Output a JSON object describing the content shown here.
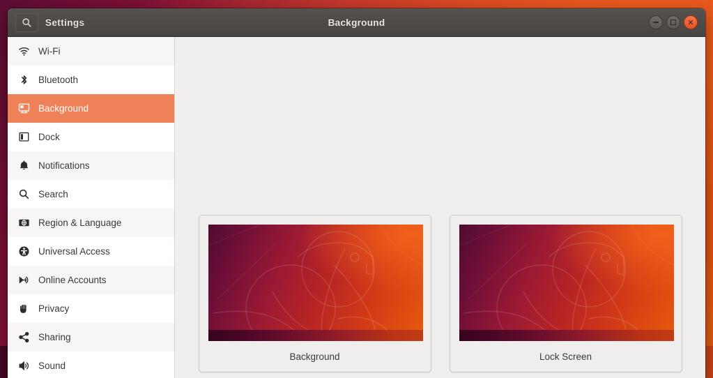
{
  "window": {
    "app_name": "Settings",
    "title": "Background",
    "search_icon": "search-icon",
    "controls": {
      "minimize": "minimize-button",
      "maximize": "maximize-button",
      "close": "close-button"
    }
  },
  "sidebar": {
    "items": [
      {
        "label": "Wi-Fi",
        "icon": "wifi-icon",
        "selected": false
      },
      {
        "label": "Bluetooth",
        "icon": "bluetooth-icon",
        "selected": false
      },
      {
        "label": "Background",
        "icon": "background-icon",
        "selected": true
      },
      {
        "label": "Dock",
        "icon": "dock-icon",
        "selected": false
      },
      {
        "label": "Notifications",
        "icon": "bell-icon",
        "selected": false
      },
      {
        "label": "Search",
        "icon": "search-icon",
        "selected": false
      },
      {
        "label": "Region & Language",
        "icon": "region-language-icon",
        "selected": false
      },
      {
        "label": "Universal Access",
        "icon": "accessibility-icon",
        "selected": false
      },
      {
        "label": "Online Accounts",
        "icon": "online-accounts-icon",
        "selected": false
      },
      {
        "label": "Privacy",
        "icon": "hand-icon",
        "selected": false
      },
      {
        "label": "Sharing",
        "icon": "share-icon",
        "selected": false
      },
      {
        "label": "Sound",
        "icon": "volume-icon",
        "selected": false
      }
    ]
  },
  "main": {
    "cards": [
      {
        "label": "Background",
        "wallpaper": "ubuntu-bionic-beaver"
      },
      {
        "label": "Lock Screen",
        "wallpaper": "ubuntu-bionic-beaver"
      }
    ]
  },
  "colors": {
    "accent": "#ef8159",
    "titlebar": "#4e4b48",
    "content_bg": "#f0efee",
    "sidebar_bg": "#ffffff",
    "sidebar_alt": "#f7f6f5",
    "close_button": "#e2542a"
  }
}
